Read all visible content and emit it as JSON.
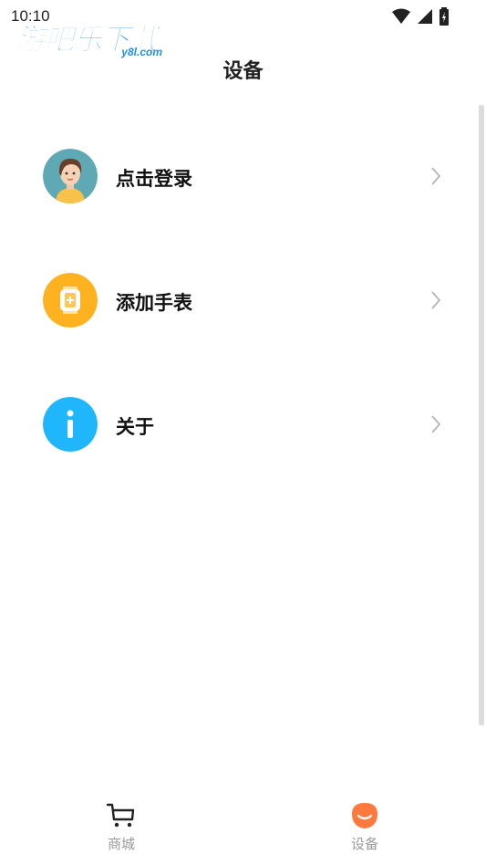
{
  "status_bar": {
    "time": "10:10"
  },
  "watermark": {
    "main": "游吧乐下载",
    "sub": "y8l.com"
  },
  "header": {
    "title": "设备"
  },
  "menu": {
    "items": [
      {
        "label": "点击登录",
        "icon": "user-avatar-icon"
      },
      {
        "label": "添加手表",
        "icon": "add-watch-icon"
      },
      {
        "label": "关于",
        "icon": "info-icon"
      }
    ]
  },
  "tabbar": {
    "tabs": [
      {
        "label": "商城",
        "icon": "cart-icon",
        "active": false
      },
      {
        "label": "设备",
        "icon": "device-icon",
        "active": true
      }
    ]
  },
  "colors": {
    "accent_orange": "#ffb21f",
    "info_blue": "#1fb6fb",
    "active_tab": "#ff7a3c",
    "avatar_bg": "#5fa9b4"
  }
}
